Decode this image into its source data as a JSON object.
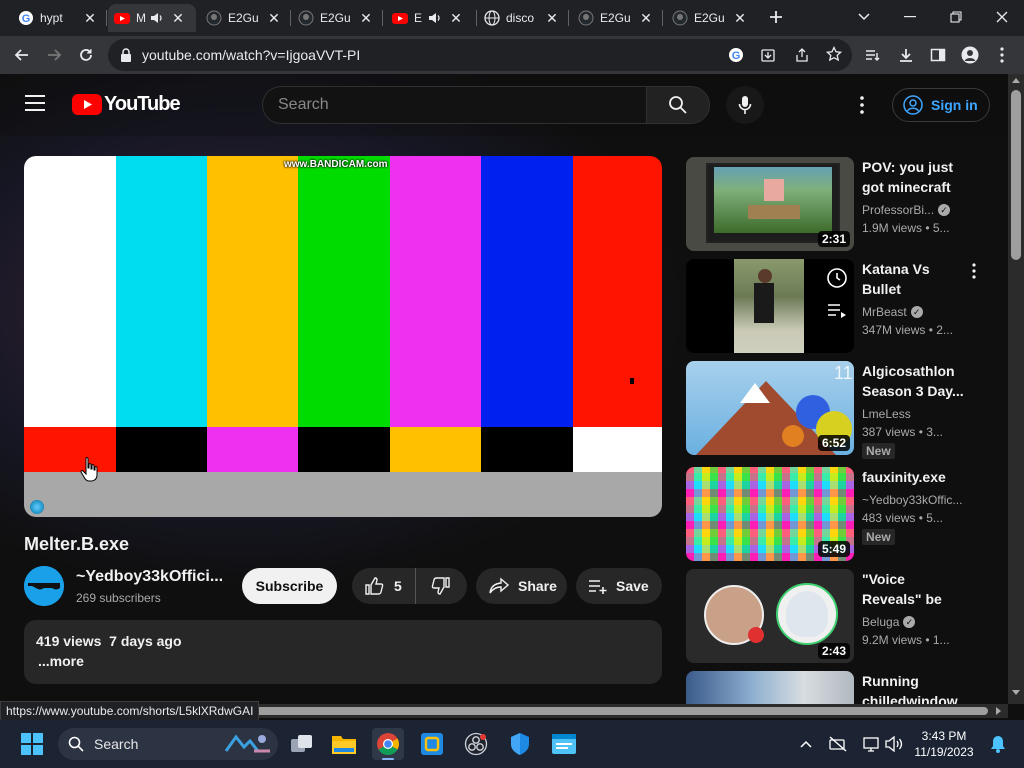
{
  "browser": {
    "tabs": [
      {
        "title": "hypt",
        "icon": "google-icon"
      },
      {
        "title": "M",
        "icon": "youtube-icon",
        "active": true
      },
      {
        "title": "E2Gu",
        "icon": "github-icon"
      },
      {
        "title": "E2Gu",
        "icon": "github-icon"
      },
      {
        "title": "E",
        "icon": "youtube-icon"
      },
      {
        "title": "disco",
        "icon": "globe-icon"
      },
      {
        "title": "E2Gu",
        "icon": "github-icon"
      },
      {
        "title": "E2Gu",
        "icon": "github-icon"
      }
    ],
    "url": "youtube.com/watch?v=IjgoaVVT-PI",
    "status_url": "https://www.youtube.com/shorts/L5klXRdwGAI"
  },
  "youtube": {
    "logo_text": "YouTube",
    "search_placeholder": "Search",
    "signin_label": "Sign in"
  },
  "video": {
    "title": "Melter.B.exe",
    "watermark": "www.BANDICAM.com",
    "channel_name": "~Yedboy33kOffici...",
    "subscribers": "269 subscribers",
    "subscribe_label": "Subscribe",
    "likes": "5",
    "share_label": "Share",
    "save_label": "Save",
    "views_date": "419 views  7 days ago",
    "more_label": "...more"
  },
  "related": [
    {
      "title": "POV: you just got minecraft",
      "channel": "ProfessorBi...",
      "verified": true,
      "meta": "1.9M views • 5...",
      "duration": "2:31",
      "new": ""
    },
    {
      "title": "Katana Vs Bullet",
      "channel": "MrBeast",
      "verified": true,
      "meta": "347M views • 2...",
      "duration": "",
      "new": ""
    },
    {
      "title": "Algicosathlon Season 3 Day...",
      "channel": "LmeLess",
      "verified": false,
      "meta": "387 views • 3...",
      "duration": "6:52",
      "new": "New"
    },
    {
      "title": "fauxinity.exe",
      "channel": "~Yedboy33kOffic...",
      "verified": false,
      "meta": "483 views • 5...",
      "duration": "5:49",
      "new": "New"
    },
    {
      "title": "\"Voice Reveals\" be like...",
      "channel": "Beluga",
      "verified": true,
      "meta": "9.2M views • 1...",
      "duration": "2:43",
      "new": ""
    },
    {
      "title": "Running chilledwindow",
      "channel": "",
      "verified": false,
      "meta": "",
      "duration": "",
      "new": ""
    }
  ],
  "taskbar": {
    "search_label": "Search",
    "time": "3:43 PM",
    "date": "11/19/2023"
  }
}
